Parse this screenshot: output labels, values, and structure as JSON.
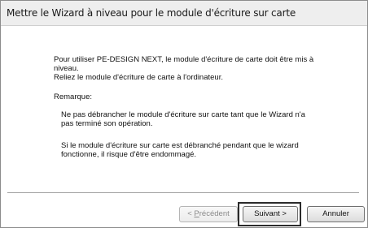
{
  "window": {
    "title": "Mettre le Wizard à niveau pour le module d'écriture sur carte"
  },
  "content": {
    "intro_line1": "Pour utiliser PE-DESIGN NEXT, le module d'écriture de carte doit être mis à",
    "intro_line2": "niveau.",
    "intro_line3": "Reliez le module d'écriture de carte à l'ordinateur.",
    "remarque": "Remarque:",
    "note1_line1": "Ne pas débrancher le module d'écriture sur carte tant que le Wizard n'a",
    "note1_line2": "pas terminé son opération.",
    "note2_line1": "Si le module d'écriture sur carte est débranché pendant que le wizard",
    "note2_line2": "fonctionne, il risque d'être endommagé."
  },
  "buttons": {
    "prev_prefix": "< ",
    "prev_mnemonic": "P",
    "prev_rest": "récédent",
    "next": "Suivant >",
    "cancel": "Annuler"
  }
}
